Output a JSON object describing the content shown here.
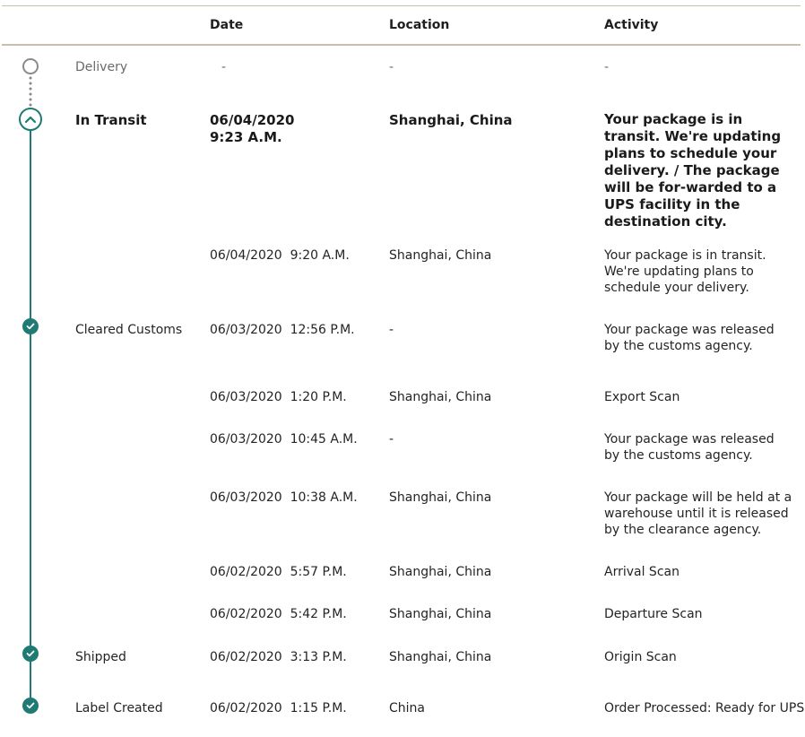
{
  "header": {
    "date": "Date",
    "location": "Location",
    "activity": "Activity"
  },
  "delivery": {
    "status": "Delivery",
    "date": "-",
    "location": "-",
    "activity": "-"
  },
  "in_transit": {
    "status": "In Transit",
    "date_line1": "06/04/2020",
    "date_line2": "9:23 A.M.",
    "location": "Shanghai, China",
    "activity": "Your package is in transit. We're updating plans to schedule your delivery. / The package will be for-warded to a UPS facility in the destination city."
  },
  "rows": [
    {
      "status": "",
      "date": "06/04/2020  9:20 A.M.",
      "location": "Shanghai, China",
      "activity": "Your package is in transit. We're updating plans to schedule your delivery."
    },
    {
      "status": "Cleared Customs",
      "date": "06/03/2020  12:56 P.M.",
      "location": "-",
      "activity": "Your package was released by the customs agency."
    },
    {
      "status": "",
      "date": "06/03/2020  1:20 P.M.",
      "location": "Shanghai, China",
      "activity": "Export Scan"
    },
    {
      "status": "",
      "date": "06/03/2020  10:45 A.M.",
      "location": "-",
      "activity": "Your package was released by the customs agency."
    },
    {
      "status": "",
      "date": "06/03/2020  10:38 A.M.",
      "location": "Shanghai, China",
      "activity": "Your package will be held at a warehouse until it is released by the clearance agency."
    },
    {
      "status": "",
      "date": "06/02/2020  5:57 P.M.",
      "location": "Shanghai, China",
      "activity": "Arrival Scan"
    },
    {
      "status": "",
      "date": "06/02/2020  5:42 P.M.",
      "location": "Shanghai, China",
      "activity": "Departure Scan"
    },
    {
      "status": "Shipped",
      "date": "06/02/2020  3:13 P.M.",
      "location": "Shanghai, China",
      "activity": "Origin Scan"
    },
    {
      "status": "Label Created",
      "date": "06/02/2020  1:15 P.M.",
      "location": "China",
      "activity": "Order Processed: Ready for UPS"
    }
  ],
  "colors": {
    "accent": "#1e7b74",
    "rule": "#c9bfae"
  }
}
